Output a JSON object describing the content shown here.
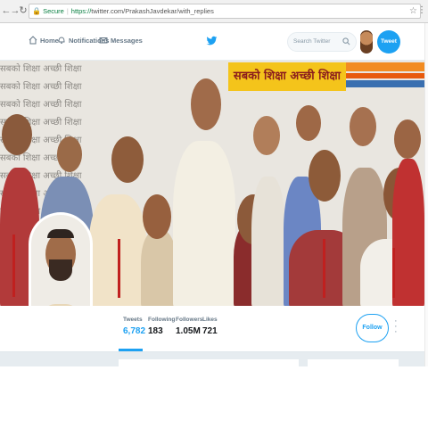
{
  "browser": {
    "secure_label": "Secure",
    "protocol": "https://",
    "url": "twitter.com/PrakashJavdekar/with_replies",
    "back_icon": "back-arrow",
    "forward_icon": "forward-arrow",
    "reload_icon": "reload",
    "star_icon": "star"
  },
  "topbar": {
    "home": "Home",
    "notifications": "Notifications",
    "messages": "Messages",
    "search_placeholder": "Search Twitter",
    "tweet_button": "Tweet"
  },
  "banner": {
    "slogan": "सबको शिक्षा अच्छी शिक्षा",
    "bg_phrase": "सबको शिक्षा अच्छी शिक्षा"
  },
  "profile": {
    "stats": [
      {
        "label": "Tweets",
        "value": "6,782"
      },
      {
        "label": "Following",
        "value": "183"
      },
      {
        "label": "Followers",
        "value": "1.05M"
      },
      {
        "label": "Likes",
        "value": "721"
      }
    ],
    "follow_button": "Follow"
  },
  "colors": {
    "accent": "#1da1f2",
    "slogan_bg": "#f4c41b",
    "slogan_text": "#8b1d1d"
  }
}
